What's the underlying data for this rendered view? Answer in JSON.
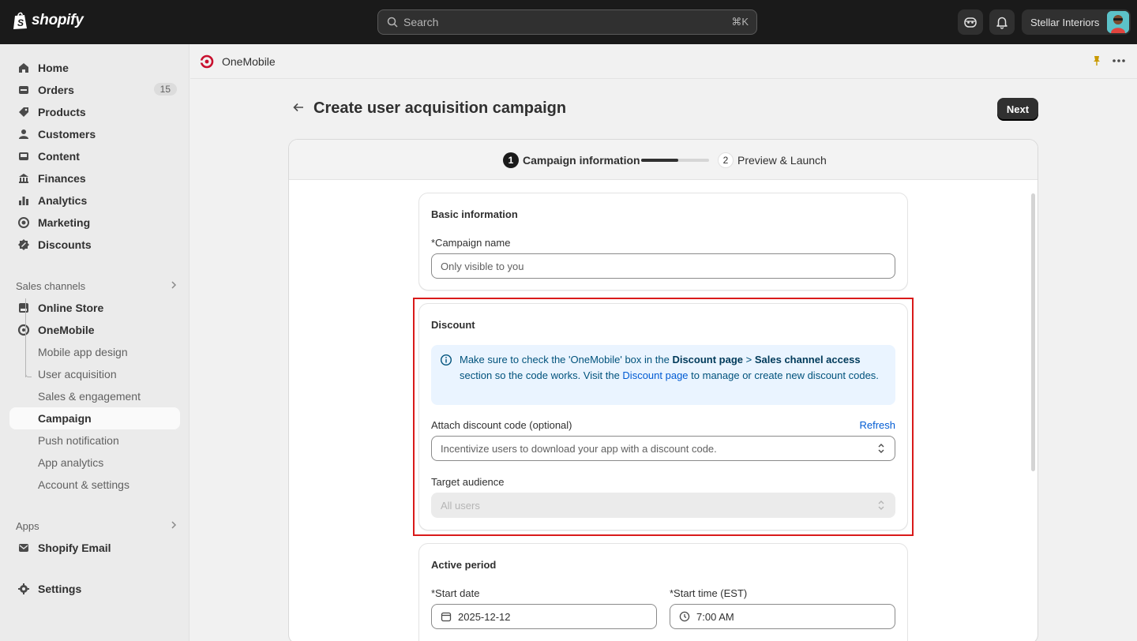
{
  "topbar": {
    "brand": "shopify",
    "search_placeholder": "Search",
    "search_shortcut": "⌘K",
    "store_name": "Stellar Interiors"
  },
  "sidebar": {
    "items": [
      {
        "label": "Home",
        "icon": "home-icon"
      },
      {
        "label": "Orders",
        "icon": "orders-icon",
        "badge": "15"
      },
      {
        "label": "Products",
        "icon": "tag-icon"
      },
      {
        "label": "Customers",
        "icon": "person-icon"
      },
      {
        "label": "Content",
        "icon": "content-icon"
      },
      {
        "label": "Finances",
        "icon": "bank-icon"
      },
      {
        "label": "Analytics",
        "icon": "bar-chart-icon"
      },
      {
        "label": "Marketing",
        "icon": "target-icon"
      },
      {
        "label": "Discounts",
        "icon": "discount-icon"
      }
    ],
    "sales_channels_heading": "Sales channels",
    "online_store": "Online Store",
    "onemobile": "OneMobile",
    "onemobile_sub": [
      "Mobile app design",
      "User acquisition",
      "Sales & engagement",
      "Campaign",
      "Push notification",
      "App analytics",
      "Account & settings"
    ],
    "apps_heading": "Apps",
    "shopify_email": "Shopify Email",
    "settings": "Settings"
  },
  "appbar": {
    "app_name": "OneMobile"
  },
  "page": {
    "title": "Create user acquisition campaign",
    "next_label": "Next",
    "steps": [
      {
        "num": "1",
        "label": "Campaign information"
      },
      {
        "num": "2",
        "label": "Preview & Launch"
      }
    ],
    "step_progress": 0.55
  },
  "basic_info": {
    "title": "Basic information",
    "campaign_name_label": "*Campaign name",
    "campaign_name_placeholder": "Only visible to you"
  },
  "discount": {
    "title": "Discount",
    "banner_part1": "Make sure to check the 'OneMobile' box in the ",
    "banner_bold1": "Discount page",
    "banner_part2": " > ",
    "banner_bold2": "Sales channel access",
    "banner_part3": " section so the code works. Visit the ",
    "banner_link": "Discount page",
    "banner_part4": " to manage or create new discount codes.",
    "attach_label": "Attach discount code (optional)",
    "refresh_label": "Refresh",
    "attach_placeholder": "Incentivize users to download your app with a discount code.",
    "audience_label": "Target audience",
    "audience_value": "All users"
  },
  "active_period": {
    "title": "Active period",
    "start_date_label": "*Start date",
    "start_date_value": "2025-12-12",
    "start_time_label": "*Start time (EST)",
    "start_time_value": "7:00 AM"
  },
  "colors": {
    "accent_link": "#005bd3",
    "highlight": "#d91a1a",
    "banner_bg": "#eaf4ff"
  }
}
